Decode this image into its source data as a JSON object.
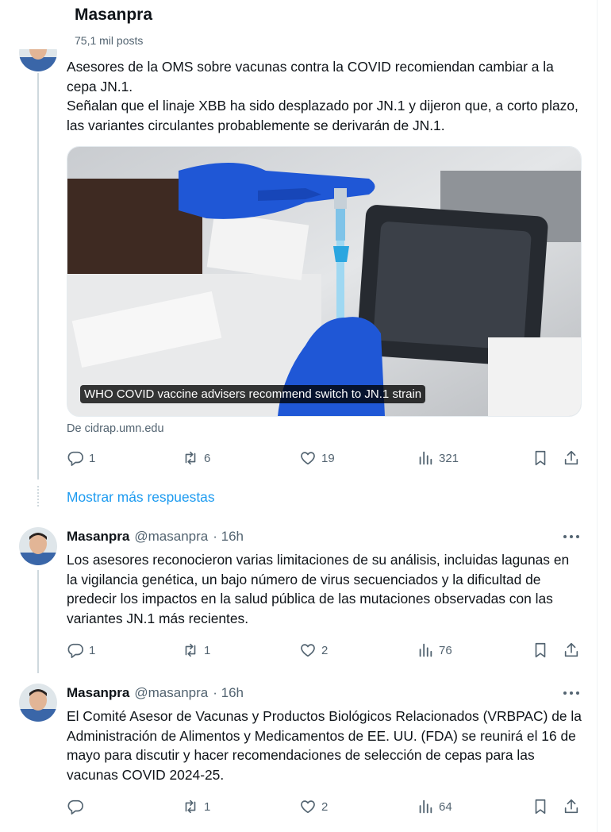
{
  "header": {
    "title": "Masanpra",
    "subtitle": "75,1 mil posts"
  },
  "tweets": [
    {
      "text": "Asesores de la OMS sobre vacunas contra la COVID recomiendan cambiar a la cepa JN.1.\nSeñalan que el linaje XBB ha sido desplazado por JN.1 y dijeron que, a corto plazo, las variantes circulantes probablemente se derivarán de JN.1.",
      "card": {
        "caption": "WHO COVID vaccine advisers recommend switch to JN.1 strain",
        "source": "De cidrap.umn.edu"
      },
      "replies": "1",
      "reposts": "6",
      "likes": "19",
      "views": "321"
    },
    {
      "name": "Masanpra",
      "handle": "@masanpra",
      "time": "· 16h",
      "text": "Los asesores reconocieron varias limitaciones de su análisis, incluidas lagunas en la vigilancia genética, un bajo número de virus secuenciados y la dificultad de predecir los impactos en la salud pública de las mutaciones observadas con las variantes JN.1 más recientes.",
      "replies": "1",
      "reposts": "1",
      "likes": "2",
      "views": "76"
    },
    {
      "name": "Masanpra",
      "handle": "@masanpra",
      "time": "· 16h",
      "text": "El Comité Asesor de Vacunas y Productos Biológicos Relacionados (VRBPAC) de la Administración de Alimentos y Medicamentos de EE. UU. (FDA) se reunirá el 16 de mayo para discutir y hacer recomendaciones de selección de cepas para las vacunas COVID 2024-25.",
      "replies": "",
      "reposts": "1",
      "likes": "2",
      "views": "64"
    }
  ],
  "show_more": "Mostrar más respuestas",
  "colors": {
    "accent": "#1d9bf0",
    "text": "#0f1419",
    "muted": "#536471",
    "line": "#cfd9de"
  },
  "icons": [
    "reply-icon",
    "repost-icon",
    "like-icon",
    "views-icon",
    "bookmark-icon",
    "share-icon",
    "more-icon"
  ]
}
